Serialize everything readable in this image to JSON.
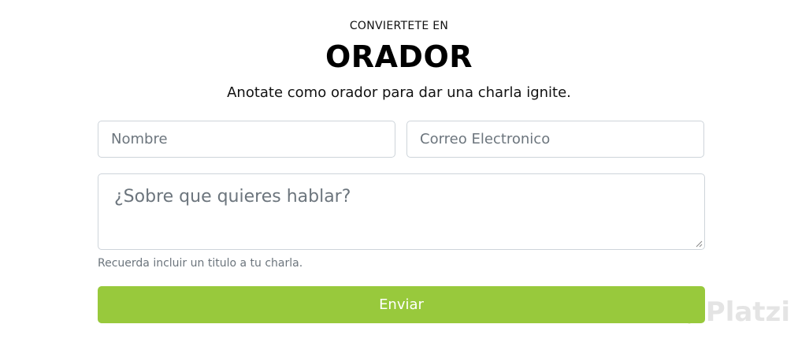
{
  "header": {
    "kicker": "CONVIERTETE EN",
    "title": "ORADOR",
    "subtitle": "Anotate como orador para dar una charla ignite."
  },
  "form": {
    "name_input": {
      "placeholder": "Nombre",
      "value": ""
    },
    "email_input": {
      "placeholder": "Correo Electronico",
      "value": ""
    },
    "topic_textarea": {
      "placeholder": "¿Sobre que quieres hablar?",
      "value": ""
    },
    "help_text": "Recuerda incluir un titulo a tu charla.",
    "submit_label": "Enviar"
  },
  "watermark": {
    "text": "Platzi",
    "icon": "platzi-logo-icon"
  },
  "colors": {
    "accent": "#98c93c",
    "input_border": "#ced4da",
    "placeholder": "#6c757d",
    "help_text": "#6c757d"
  }
}
